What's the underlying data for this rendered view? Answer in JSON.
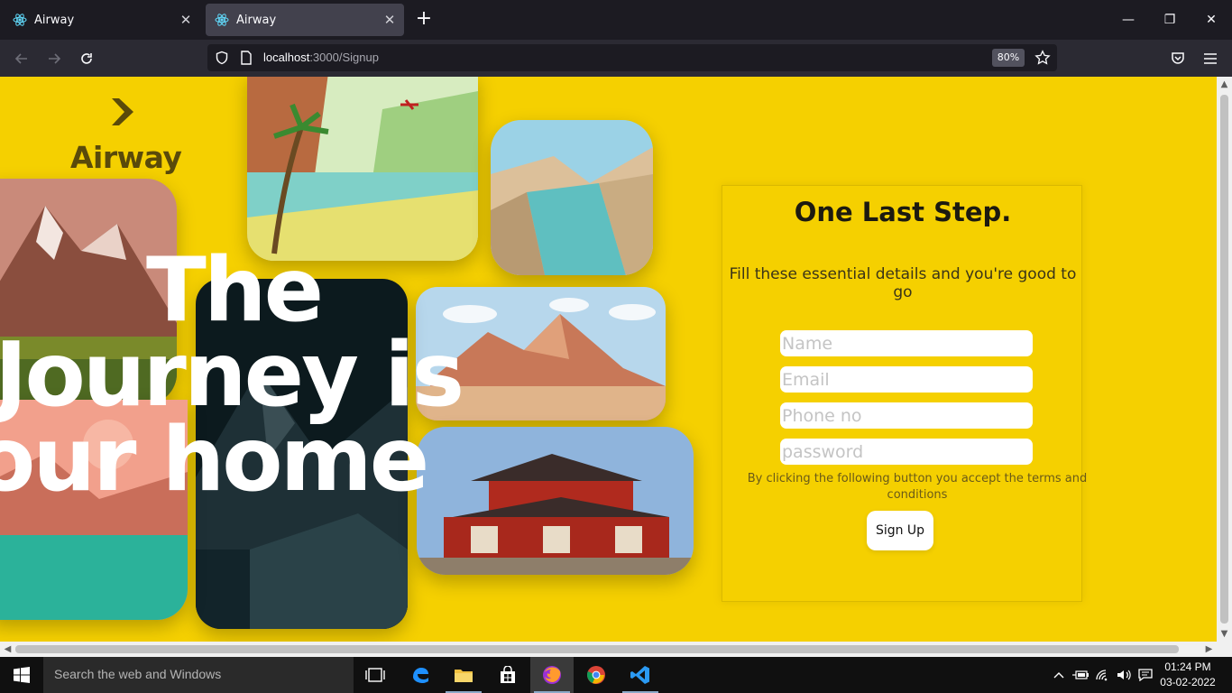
{
  "browser": {
    "tabs": [
      {
        "title": "Airway",
        "active": false
      },
      {
        "title": "Airway",
        "active": true
      }
    ],
    "url_host": "localhost",
    "url_path": ":3000/Signup",
    "zoom": "80%"
  },
  "page": {
    "logo_text": "Airway",
    "hero_lines": [
      "The",
      "Journey is",
      "our home"
    ],
    "form": {
      "title": "One Last Step.",
      "subtitle": "Fill these essential details and you're good to go",
      "name_placeholder": "Name",
      "email_placeholder": "Email",
      "phone_placeholder": "Phone no",
      "password_placeholder": "password",
      "terms": "By clicking the following button you accept the terms and conditions",
      "submit_label": "Sign Up"
    },
    "colors": {
      "background": "#f5d000",
      "text_dark": "#1c1a10"
    }
  },
  "taskbar": {
    "search_placeholder": "Search the web and Windows",
    "time": "01:24 PM",
    "date": "03-02-2022"
  }
}
